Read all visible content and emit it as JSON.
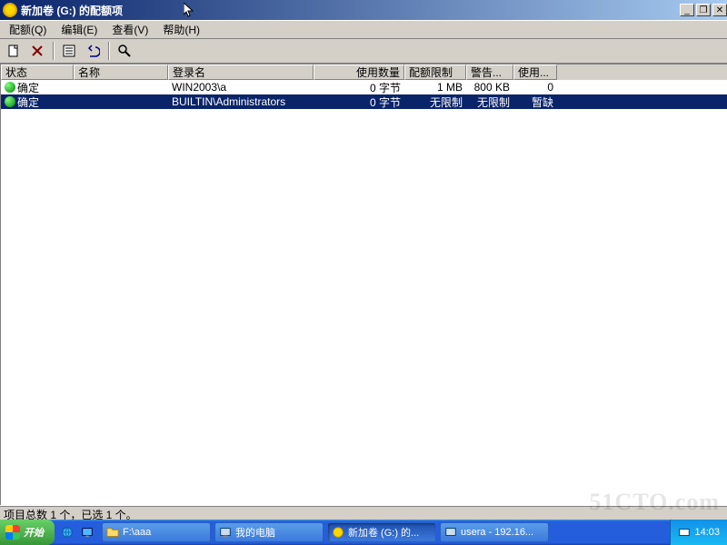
{
  "window": {
    "title": "新加卷 (G:) 的配额项",
    "minimize": "_",
    "restore": "❐",
    "close": "✕"
  },
  "menu": {
    "quota": "配额(Q)",
    "edit": "编辑(E)",
    "view": "查看(V)",
    "help": "帮助(H)"
  },
  "columns": {
    "state": "状态",
    "name": "名称",
    "login": "登录名",
    "used": "使用数量",
    "limit": "配额限制",
    "warn": "警告...",
    "usedpct": "使用..."
  },
  "rows": [
    {
      "state": "确定",
      "name": "",
      "login": "WIN2003\\a",
      "used": "0 字节",
      "limit": "1 MB",
      "warn": "800 KB",
      "usedpct": "0"
    },
    {
      "state": "确定",
      "name": "",
      "login": "BUILTIN\\Administrators",
      "used": "0 字节",
      "limit": "无限制",
      "warn": "无限制",
      "usedpct": "暂缺"
    }
  ],
  "statusbar": {
    "text": "项目总数 1 个，已选 1 个。"
  },
  "taskbar": {
    "start": "开始",
    "items": [
      {
        "label": "F:\\aaa"
      },
      {
        "label": "我的电脑"
      },
      {
        "label": "新加卷 (G:) 的..."
      },
      {
        "label": "usera - 192.16..."
      }
    ],
    "clock": "14:03"
  },
  "watermark": "51CTO.com"
}
